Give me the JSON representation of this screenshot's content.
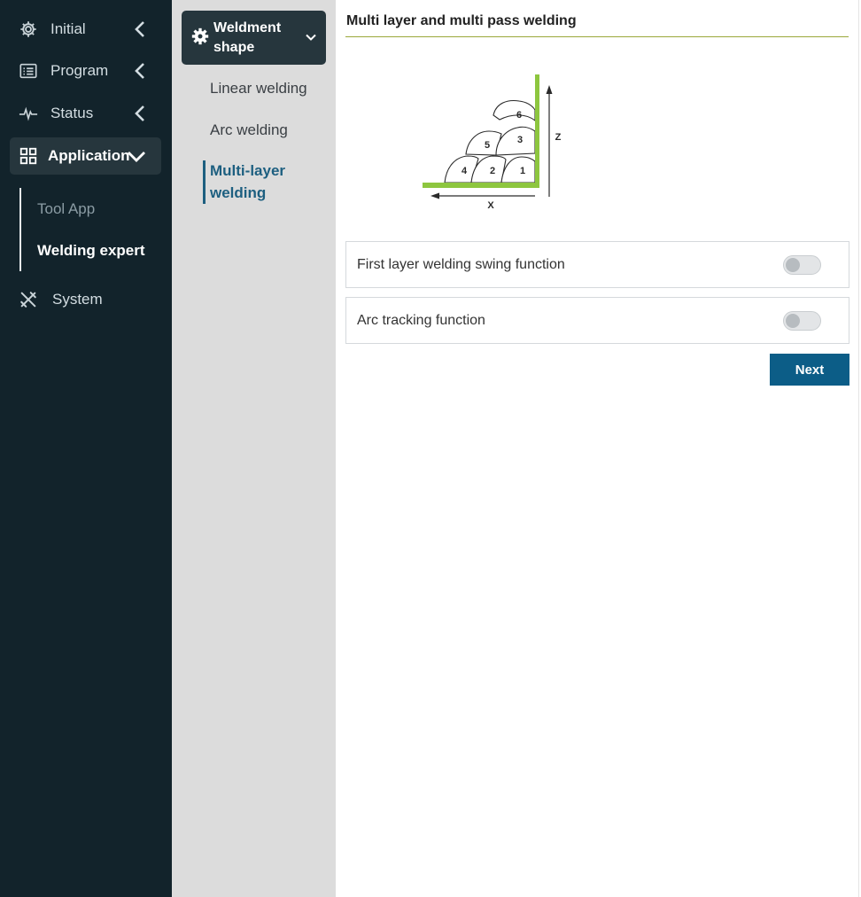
{
  "sidebar": {
    "items": [
      {
        "label": "Initial",
        "icon": "gear-icon"
      },
      {
        "label": "Program",
        "icon": "program-list-icon"
      },
      {
        "label": "Status",
        "icon": "pulse-icon"
      },
      {
        "label": "Application",
        "icon": "grid-icon"
      },
      {
        "label": "System",
        "icon": "tools-icon"
      }
    ],
    "subitems": [
      {
        "label": "Tool App"
      },
      {
        "label": "Welding expert"
      }
    ]
  },
  "middle": {
    "header": "Weldment shape",
    "items": [
      {
        "label": "Linear welding"
      },
      {
        "label": "Arc welding"
      },
      {
        "label": "Multi-layer welding"
      }
    ]
  },
  "content": {
    "title": "Multi layer and multi pass welding",
    "diagram": {
      "passes": [
        "1",
        "2",
        "3",
        "4",
        "5",
        "6"
      ],
      "axis_x": "X",
      "axis_z": "Z"
    },
    "options": [
      {
        "label": "First layer welding swing function",
        "enabled": false
      },
      {
        "label": "Arc tracking function",
        "enabled": false
      }
    ],
    "next_label": "Next"
  },
  "colors": {
    "sidebar_bg": "#12232b",
    "active_item_bg": "#26363d",
    "middle_bg": "#dcdcdc",
    "accent_blue": "#0c5d87",
    "plate_green": "#8dc63f",
    "title_rule": "#9aa83a"
  }
}
